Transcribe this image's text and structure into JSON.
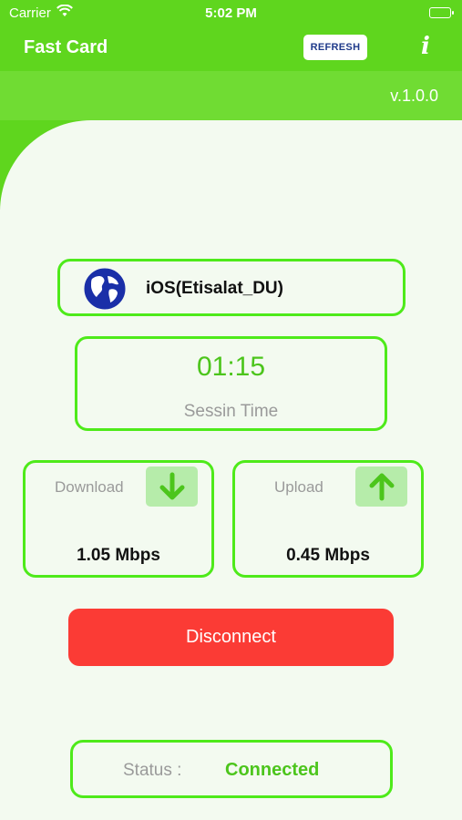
{
  "status_bar": {
    "carrier": "Carrier",
    "time": "5:02 PM"
  },
  "nav": {
    "title": "Fast Card",
    "refresh_label": "REFRESH",
    "info_label": "i"
  },
  "version": "v.1.0.0",
  "server": {
    "name": "iOS(Etisalat_DU)",
    "icon": "globe-icon"
  },
  "session": {
    "time": "01:15",
    "label": "Sessin Time"
  },
  "download": {
    "label": "Download",
    "value": "1.05 Mbps",
    "icon": "arrow-down-icon"
  },
  "upload": {
    "label": "Upload",
    "value": "0.45 Mbps",
    "icon": "arrow-up-icon"
  },
  "disconnect_label": "Disconnect",
  "connection_status": {
    "label": "Status :",
    "value": "Connected"
  },
  "colors": {
    "primary_green": "#5fd61e",
    "border_green": "#4eea1a",
    "text_green": "#4cc51c",
    "danger_red": "#fb3b35",
    "background": "#f3faf0"
  }
}
